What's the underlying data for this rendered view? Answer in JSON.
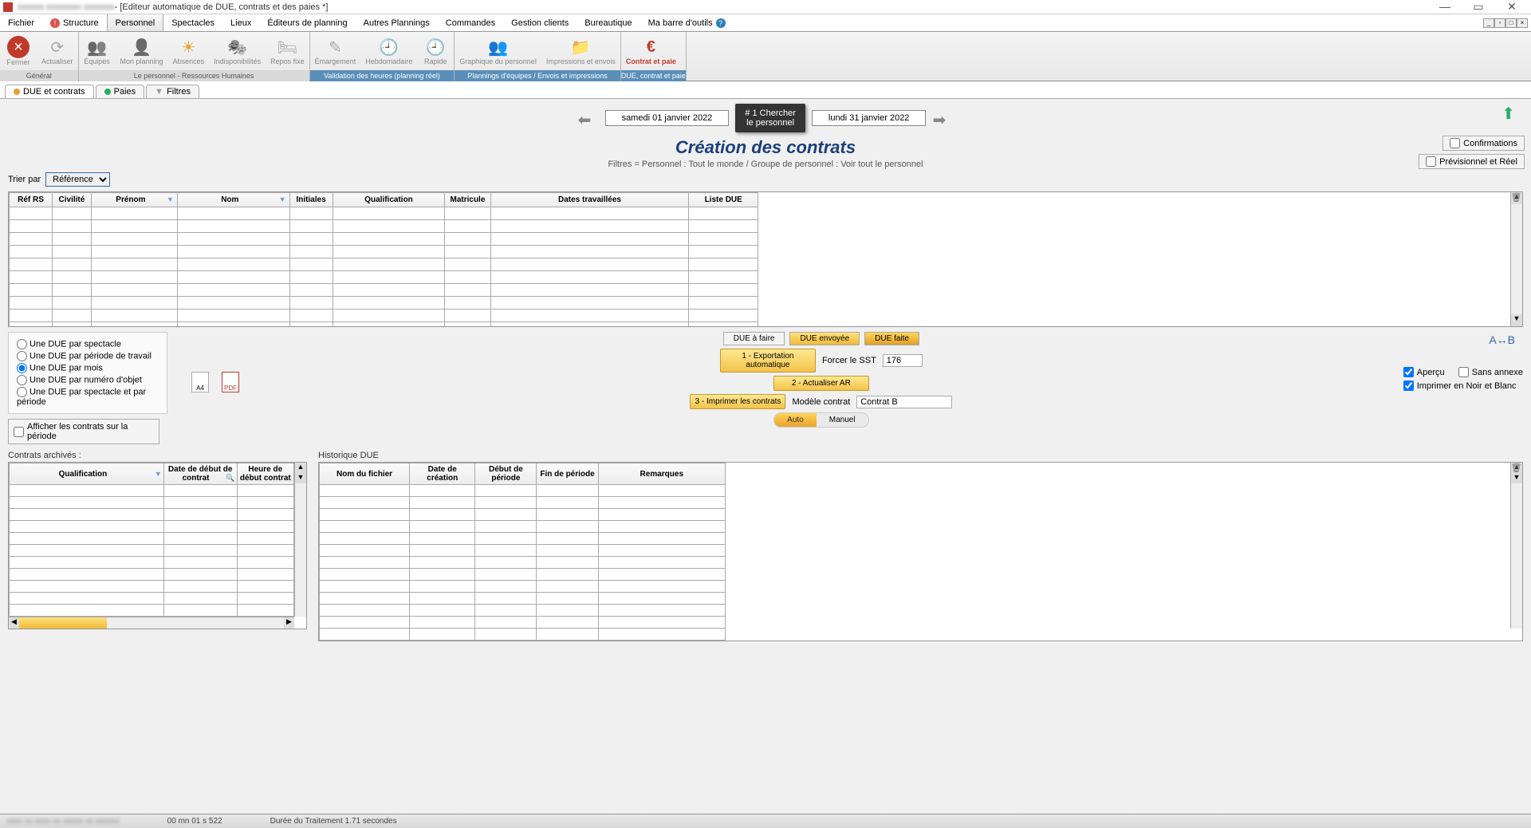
{
  "title_bar": {
    "app_obscured": "—",
    "doc_title": "- [Editeur automatique de DUE, contrats et des paies *]"
  },
  "menu": {
    "items": [
      "Fichier",
      "Structure",
      "Personnel",
      "Spectacles",
      "Lieux",
      "Éditeurs de planning",
      "Autres Plannings",
      "Commandes",
      "Gestion clients",
      "Bureautique",
      "Ma barre d'outils"
    ],
    "active_index": 2
  },
  "ribbon": {
    "groups": [
      {
        "label": "Général",
        "items": [
          {
            "name": "close",
            "label": "Fermer",
            "icon": "ico-x"
          },
          {
            "name": "refresh",
            "label": "Actualiser",
            "icon": "ico-refresh"
          }
        ]
      },
      {
        "label": "Le personnel - Ressources Humaines",
        "items": [
          {
            "name": "teams",
            "label": "Équipes",
            "icon": "ico-people"
          },
          {
            "name": "myplan",
            "label": "Mon planning",
            "icon": "ico-person"
          },
          {
            "name": "abs",
            "label": "Absences",
            "icon": "ico-sun"
          },
          {
            "name": "indisp",
            "label": "Indisponibilités",
            "icon": "ico-mask"
          },
          {
            "name": "repos",
            "label": "Repos fixe",
            "icon": "ico-cal"
          }
        ]
      },
      {
        "label": "Validation des heures (planning réel)",
        "blue": true,
        "items": [
          {
            "name": "emarge",
            "label": "Émargement",
            "icon": "ico-edit"
          },
          {
            "name": "hebdo",
            "label": "Hebdomadaire",
            "icon": "ico-clock"
          },
          {
            "name": "rapide",
            "label": "Rapide",
            "icon": "ico-clock"
          }
        ]
      },
      {
        "label": "Plannings d'équipes / Envois et impressions",
        "blue": true,
        "items": [
          {
            "name": "graph",
            "label": "Graphique du personnel",
            "icon": "ico-graph"
          },
          {
            "name": "impr",
            "label": "Impressions et envois",
            "icon": "ico-print"
          }
        ]
      },
      {
        "label": "DUE, contrat et paie",
        "blue": true,
        "items": [
          {
            "name": "contrat",
            "label": "Contrat et paie",
            "icon": "ico-euro",
            "active": true
          }
        ]
      }
    ]
  },
  "subtabs": {
    "items": [
      {
        "label": "DUE et contrats",
        "dot": "orange",
        "active": true
      },
      {
        "label": "Paies",
        "dot": "green"
      },
      {
        "label": "Filtres",
        "funnel": true
      }
    ]
  },
  "date_nav": {
    "from": "samedi 01 janvier 2022",
    "to": "lundi 31 janvier 2022",
    "search_btn_line1": "# 1 Chercher",
    "search_btn_line2": "le personnel"
  },
  "heading": "Création des contrats",
  "filters_line": "Filtres = Personnel : Tout le monde / Groupe de personnel : Voir tout le personnel",
  "right_options": {
    "confirmations": "Confirmations",
    "prev_reel": "Prévisionnel et Réel"
  },
  "sort": {
    "label": "Trier par",
    "value": "Référence"
  },
  "main_table": {
    "headers": [
      "Réf RS",
      "Civilité",
      "Prénom",
      "Nom",
      "Initiales",
      "Qualification",
      "Matricule",
      "Dates travaillées",
      "Liste DUE"
    ],
    "filter_cols": [
      2,
      3
    ],
    "rows": 10
  },
  "radio_options": [
    "Une DUE par spectacle",
    "Une DUE par période de travail",
    "Une DUE par mois",
    "Une DUE par numéro d'objet",
    "Une DUE par spectacle et par période"
  ],
  "radio_selected": 2,
  "show_contracts_label": "Afficher les contrats sur la période",
  "doc_icons": {
    "a4": "A4",
    "pdf": "PDF"
  },
  "due_status": {
    "todo": "DUE à faire",
    "sent": "DUE envoyée",
    "done": "DUE faite"
  },
  "action_buttons": [
    "1 - Exportation automatique",
    "2 - Actualiser AR",
    "3 - Imprimer les contrats"
  ],
  "sst": {
    "label": "Forcer le SST",
    "value": "176"
  },
  "model_contract": {
    "label": "Modèle contrat",
    "value": "Contrat B"
  },
  "toggle": {
    "auto": "Auto",
    "manual": "Manuel"
  },
  "check_options": {
    "apercu": "Aperçu",
    "sans_annexe": "Sans annexe",
    "noir_blanc": "Imprimer en Noir et Blanc"
  },
  "bottom_left": {
    "title": "Contrats archivés :",
    "headers": [
      "Qualification",
      "Date de début de contrat",
      "Heure de début contrat"
    ],
    "rows": 11,
    "filter_cols": [
      0
    ],
    "search_cols": [
      1
    ]
  },
  "bottom_right": {
    "title": "Historique DUE",
    "headers": [
      "Nom du fichier",
      "Date de création",
      "Début de période",
      "Fin de période",
      "Remarques"
    ],
    "rows": 13
  },
  "status_bar": {
    "left_obscured": "—",
    "time": "00 mn 01 s 522",
    "duration": "Durée du Traitement  1.71 secondes"
  },
  "colors": {
    "accent_yellow": "#f3c24a",
    "accent_red": "#c0392b",
    "heading_blue": "#1c3f7c"
  }
}
